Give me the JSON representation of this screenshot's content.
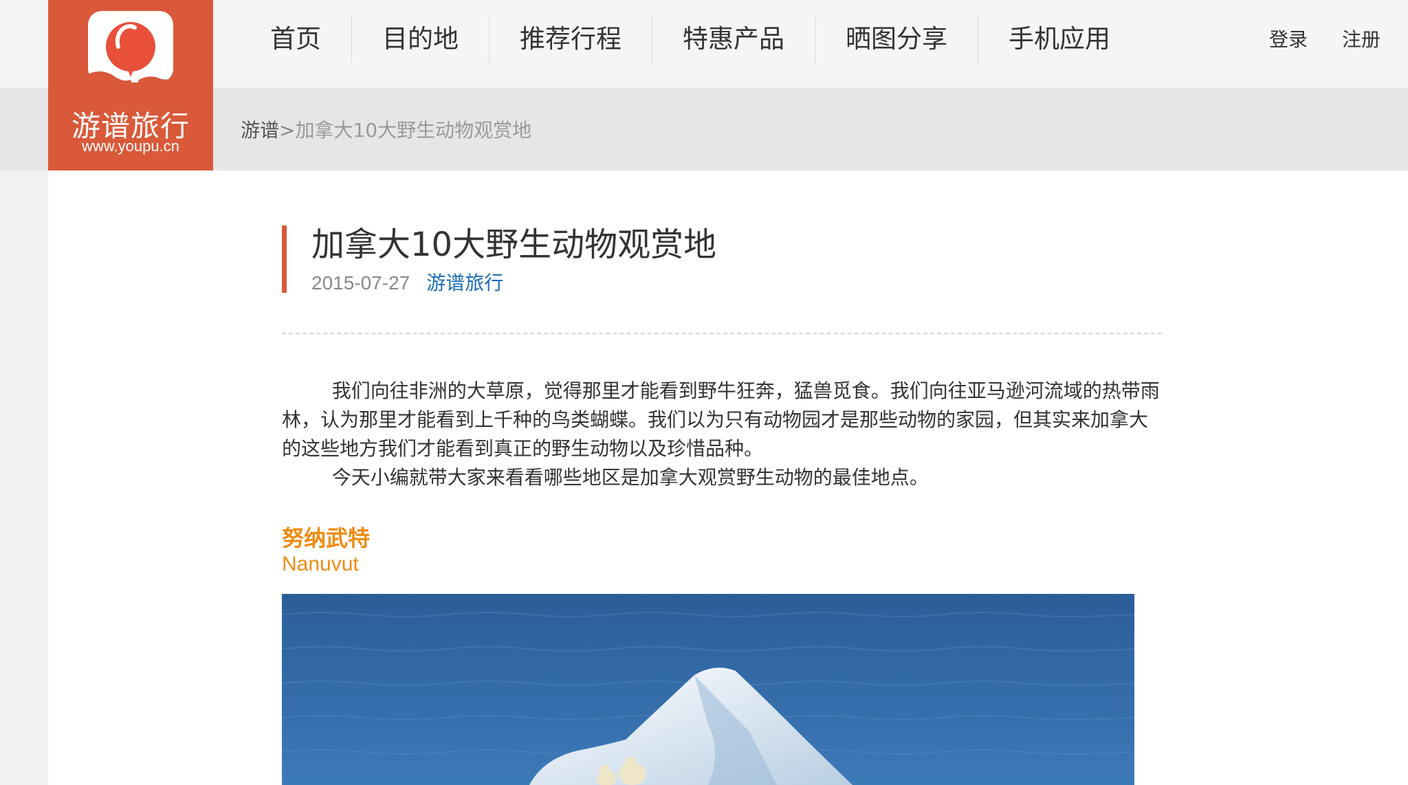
{
  "logo": {
    "name": "游谱旅行",
    "url": "www.youpu.cn"
  },
  "nav": {
    "items": [
      "首页",
      "目的地",
      "推荐行程",
      "特惠产品",
      "晒图分享",
      "手机应用"
    ]
  },
  "auth": {
    "login": "登录",
    "register": "注册"
  },
  "breadcrumb": {
    "home": "游谱",
    "separator": ">",
    "current": "加拿大10大野生动物观赏地"
  },
  "article": {
    "title": "加拿大10大野生动物观赏地",
    "date": "2015-07-27",
    "source": "游谱旅行",
    "paragraphs": [
      "我们向往非洲的大草原，觉得那里才能看到野牛狂奔，猛兽觅食。我们向往亚马逊河流域的热带雨林，认为那里才能看到上千种的鸟类蝴蝶。我们以为只有动物园才是那些动物的家园，但其实来加拿大的这些地方我们才能看到真正的野生动物以及珍惜品种。",
      "今天小编就带大家来看看哪些地区是加拿大观赏野生动物的最佳地点。"
    ],
    "section": {
      "title_cn": "努纳武特",
      "title_en": "Nanuvut"
    }
  },
  "colors": {
    "brand": "#d9593a",
    "section_heading": "#f08a11",
    "link": "#1a6bb8"
  }
}
